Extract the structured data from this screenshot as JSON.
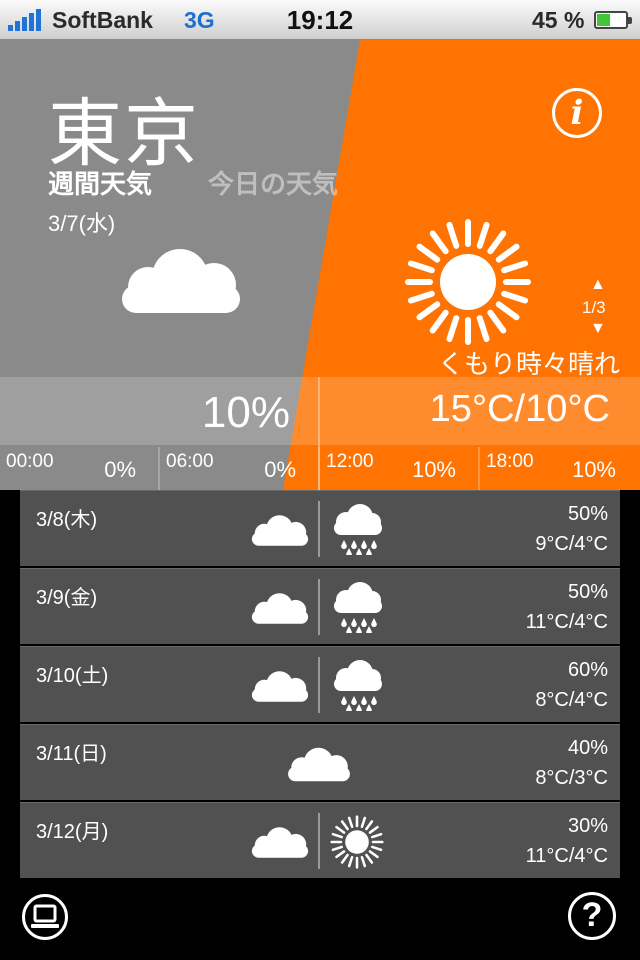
{
  "status_bar": {
    "carrier": "SoftBank",
    "network": "3G",
    "time": "19:12",
    "battery_percent_label": "45 %",
    "battery_level": 0.45
  },
  "hero": {
    "city": "東京",
    "tab_week": "週間天気",
    "tab_today": "今日の天気",
    "date": "3/7(水)",
    "info_icon": "info-icon",
    "page_indicator": "1/3",
    "condition": "くもり時々晴れ",
    "rain_chance": "10%",
    "temp_range": "15°C/10°C",
    "colors": {
      "gray_panel": "#8a8a8a",
      "orange_panel": "#fe7302"
    },
    "hourly": [
      {
        "time": "00:00",
        "pct": "0%"
      },
      {
        "time": "06:00",
        "pct": "0%"
      },
      {
        "time": "12:00",
        "pct": "10%"
      },
      {
        "time": "18:00",
        "pct": "10%"
      }
    ]
  },
  "week": [
    {
      "date": "3/8(木)",
      "pct": "50%",
      "temp": "9°C/4°C",
      "icons": [
        "cloud-icon",
        "rain-icon"
      ]
    },
    {
      "date": "3/9(金)",
      "pct": "50%",
      "temp": "11°C/4°C",
      "icons": [
        "cloud-icon",
        "rain-icon"
      ]
    },
    {
      "date": "3/10(土)",
      "pct": "60%",
      "temp": "8°C/4°C",
      "icons": [
        "cloud-icon",
        "rain-icon"
      ]
    },
    {
      "date": "3/11(日)",
      "pct": "40%",
      "temp": "8°C/3°C",
      "icons": [
        "cloud-icon"
      ]
    },
    {
      "date": "3/12(月)",
      "pct": "30%",
      "temp": "11°C/4°C",
      "icons": [
        "cloud-icon",
        "sun-icon"
      ]
    }
  ],
  "toolbar": {
    "left_icon": "laptop-icon",
    "right_icon": "help-icon",
    "help_glyph": "?"
  }
}
